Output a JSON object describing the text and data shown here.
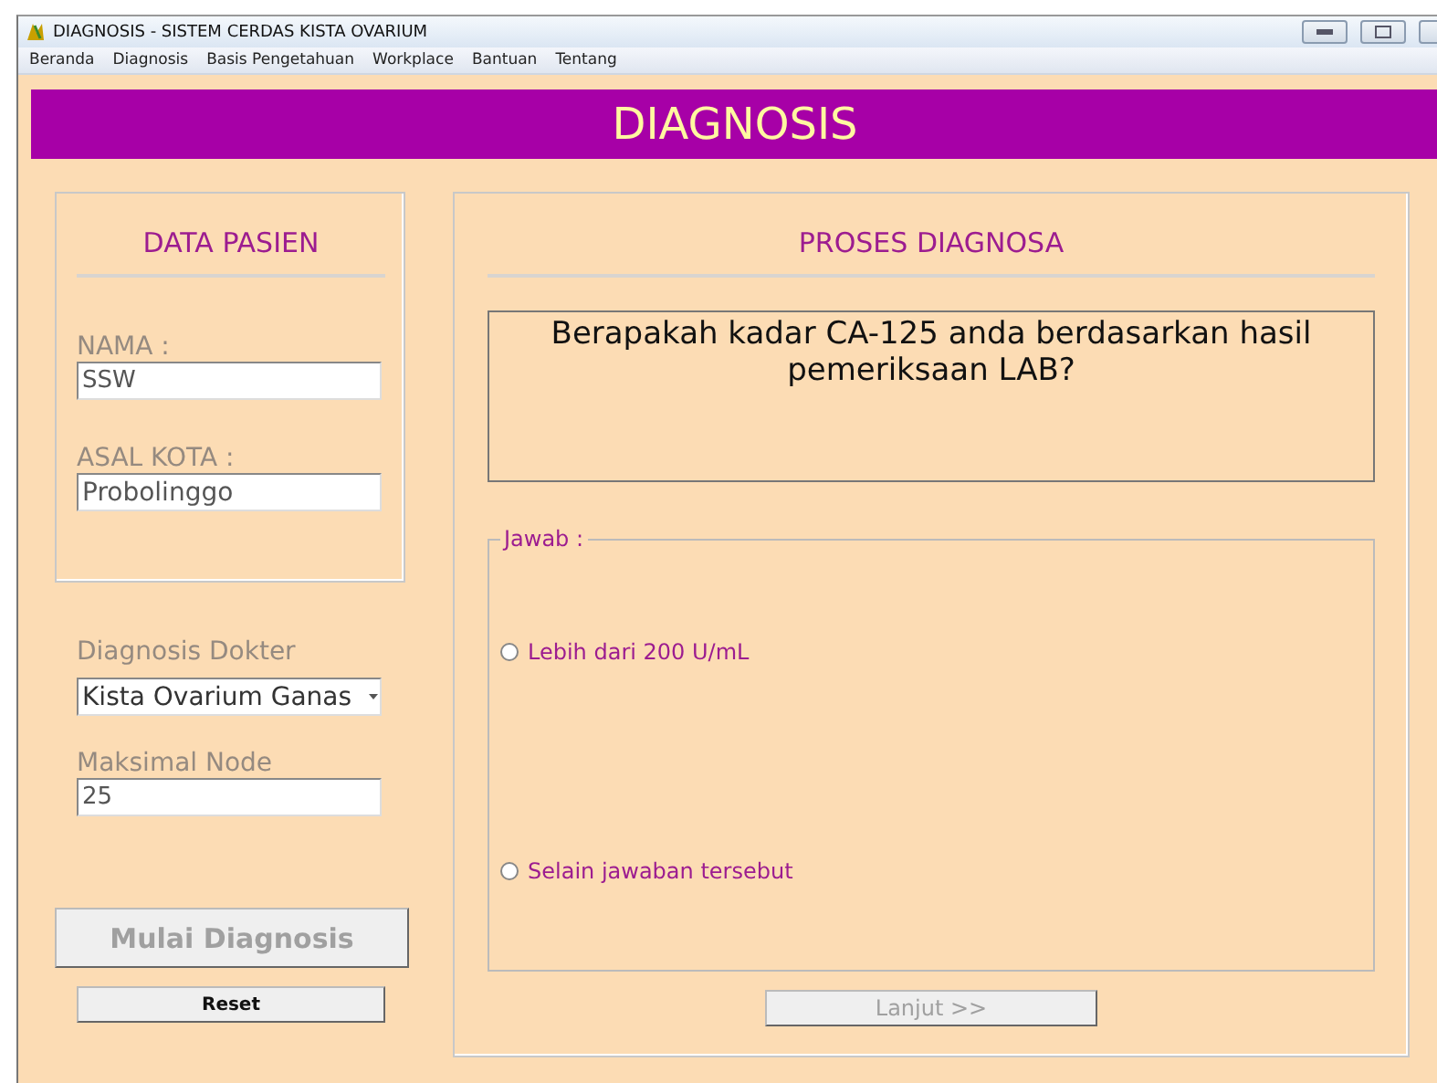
{
  "window": {
    "title": "DIAGNOSIS - SISTEM CERDAS KISTA OVARIUM"
  },
  "menu": [
    "Beranda",
    "Diagnosis",
    "Basis Pengetahuan",
    "Workplace",
    "Bantuan",
    "Tentang"
  ],
  "banner": "DIAGNOSIS",
  "patient_panel": {
    "title": "DATA PASIEN",
    "fields": [
      {
        "label": "NAMA :",
        "value": "SSW"
      },
      {
        "label": "ASAL KOTA :",
        "value": "Probolinggo"
      }
    ]
  },
  "doctor_diagnosis": {
    "label": "Diagnosis Dokter",
    "value": "Kista Ovarium Ganas"
  },
  "max_node": {
    "label": "Maksimal Node",
    "value": "25"
  },
  "buttons": [
    {
      "label": "Mulai Diagnosis",
      "kind": "large",
      "disabled": true
    },
    {
      "label": "Reset",
      "kind": "small",
      "disabled": false
    }
  ],
  "process_panel": {
    "title": "PROSES DIAGNOSA",
    "question": "Berapakah kadar CA-125 anda berdasarkan hasil pemeriksaan LAB?",
    "answer_group": "Jawab :",
    "answers": [
      {
        "label": "Lebih dari 200 U/mL",
        "selected": false
      },
      {
        "label": "Selain jawaban tersebut",
        "selected": false
      }
    ],
    "next_button": {
      "label": "Lanjut >>",
      "disabled": true
    }
  }
}
